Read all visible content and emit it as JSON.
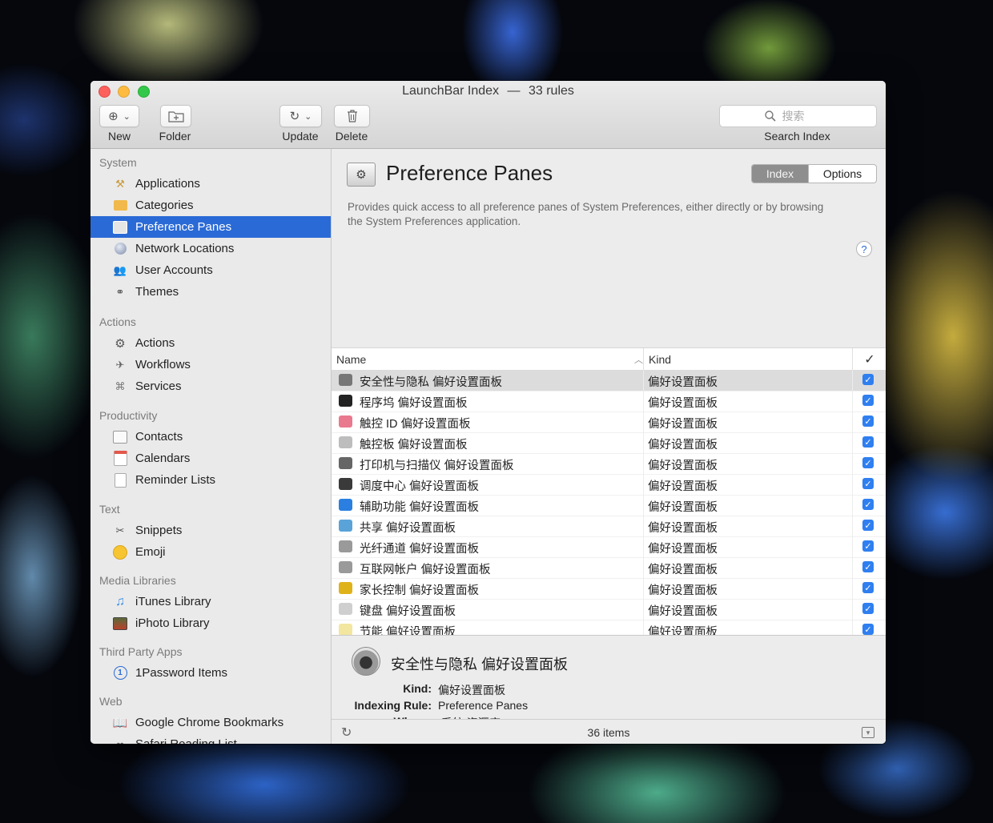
{
  "window": {
    "title": "LaunchBar Index",
    "separator": "—",
    "rules": "33 rules"
  },
  "toolbar": {
    "new_label": "New",
    "folder_label": "Folder",
    "update_label": "Update",
    "delete_label": "Delete",
    "search_label": "Search Index",
    "search_placeholder": "搜索"
  },
  "sidebar": {
    "groups": [
      {
        "header": "System",
        "items": [
          "Applications",
          "Categories",
          "Preference Panes",
          "Network Locations",
          "User Accounts",
          "Themes"
        ]
      },
      {
        "header": "Actions",
        "items": [
          "Actions",
          "Workflows",
          "Services"
        ]
      },
      {
        "header": "Productivity",
        "items": [
          "Contacts",
          "Calendars",
          "Reminder Lists"
        ]
      },
      {
        "header": "Text",
        "items": [
          "Snippets",
          "Emoji"
        ]
      },
      {
        "header": "Media Libraries",
        "items": [
          "iTunes Library",
          "iPhoto Library"
        ]
      },
      {
        "header": "Third Party Apps",
        "items": [
          "1Password Items"
        ]
      },
      {
        "header": "Web",
        "items": [
          "Google Chrome Bookmarks",
          "Safari Reading List"
        ]
      }
    ],
    "selected": "Preference Panes"
  },
  "pane": {
    "title": "Preference Panes",
    "tab_index": "Index",
    "tab_options": "Options",
    "description": "Provides quick access to all preference panes of System Preferences, either directly or by browsing the System Preferences application.",
    "help": "?"
  },
  "table": {
    "col_name": "Name",
    "col_kind": "Kind",
    "col_check": "✓",
    "rows": [
      {
        "name": "安全性与隐私 偏好设置面板",
        "kind": "偏好设置面板",
        "icon": "camera-icon",
        "color": "#777777"
      },
      {
        "name": "程序坞 偏好设置面板",
        "kind": "偏好设置面板",
        "icon": "dock-icon",
        "color": "#222222"
      },
      {
        "name": "触控 ID 偏好设置面板",
        "kind": "偏好设置面板",
        "icon": "fingerprint-icon",
        "color": "#e9798f"
      },
      {
        "name": "触控板 偏好设置面板",
        "kind": "偏好设置面板",
        "icon": "trackpad-icon",
        "color": "#bdbdbd"
      },
      {
        "name": "打印机与扫描仪 偏好设置面板",
        "kind": "偏好设置面板",
        "icon": "printer-icon",
        "color": "#666666"
      },
      {
        "name": "调度中心 偏好设置面板",
        "kind": "偏好设置面板",
        "icon": "mission-control-icon",
        "color": "#3a3a3a"
      },
      {
        "name": "辅助功能 偏好设置面板",
        "kind": "偏好设置面板",
        "icon": "accessibility-icon",
        "color": "#2a7fe0"
      },
      {
        "name": "共享 偏好设置面板",
        "kind": "偏好设置面板",
        "icon": "sharing-icon",
        "color": "#5aa3d8"
      },
      {
        "name": "光纤通道 偏好设置面板",
        "kind": "偏好设置面板",
        "icon": "fibre-channel-icon",
        "color": "#9a9a9a"
      },
      {
        "name": "互联网帐户 偏好设置面板",
        "kind": "偏好设置面板",
        "icon": "internet-accounts-icon",
        "color": "#9a9a9a"
      },
      {
        "name": "家长控制 偏好设置面板",
        "kind": "偏好设置面板",
        "icon": "parental-controls-icon",
        "color": "#e0b21a"
      },
      {
        "name": "键盘 偏好设置面板",
        "kind": "偏好设置面板",
        "icon": "keyboard-icon",
        "color": "#cfcfcf"
      },
      {
        "name": "节能 偏好设置面板",
        "kind": "偏好设置面板",
        "icon": "lightbulb-icon",
        "color": "#f2e6a0"
      }
    ]
  },
  "details": {
    "title": "安全性与隐私 偏好设置面板",
    "kind_key": "Kind:",
    "kind_val": "偏好设置面板",
    "rule_key": "Indexing Rule:",
    "rule_val": "Preference Panes",
    "where_key": "Where:",
    "where_val": "/系统/资源库/PreferencePanes"
  },
  "status": {
    "count": "36 items"
  }
}
